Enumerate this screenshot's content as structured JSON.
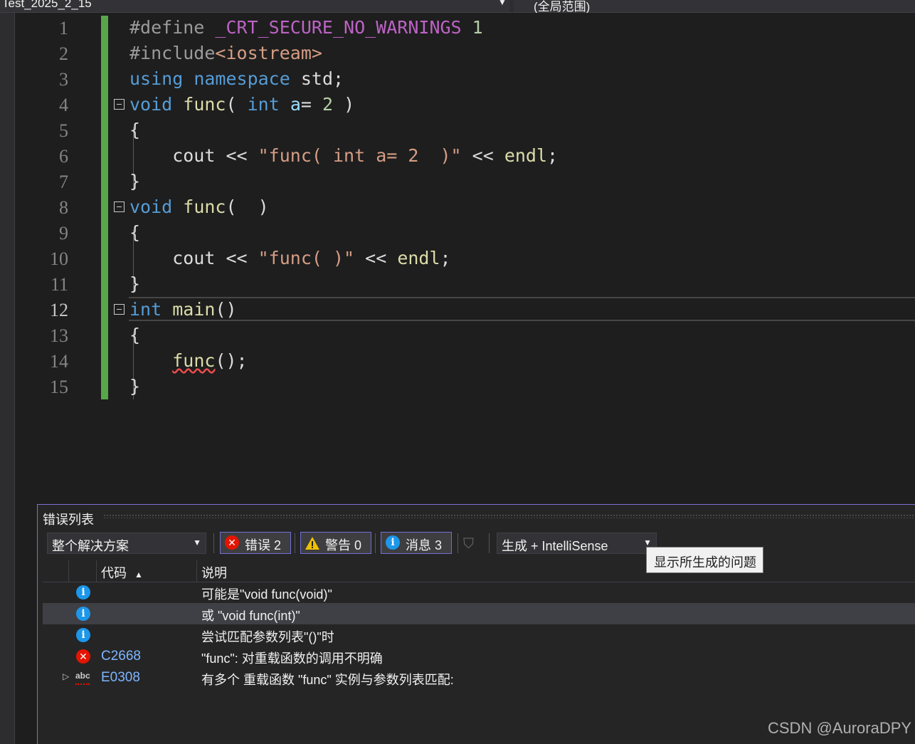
{
  "topbar": {
    "file_dropdown": "Test_2025_2_15",
    "scope_dropdown": "(全局范围)"
  },
  "editor": {
    "current_line": 12,
    "line_numbers": [
      "1",
      "2",
      "3",
      "4",
      "5",
      "6",
      "7",
      "8",
      "9",
      "10",
      "11",
      "12",
      "13",
      "14",
      "15"
    ]
  },
  "error_list": {
    "title": "错误列表",
    "scope_select": "整个解决方案",
    "errors_label": "错误 2",
    "warnings_label": "警告 0",
    "messages_label": "消息 3",
    "build_select": "生成 + IntelliSense",
    "tooltip": "显示所生成的问题",
    "columns": {
      "code": "代码",
      "description": "说明"
    },
    "rows": [
      {
        "icon": "info-icon",
        "code": "",
        "description": "可能是\"void func(void)\""
      },
      {
        "icon": "info-icon",
        "code": "",
        "description": "或    \"void func(int)\""
      },
      {
        "icon": "info-icon",
        "code": "",
        "description": "尝试匹配参数列表\"()\"时"
      },
      {
        "icon": "error-icon",
        "code": "C2668",
        "description": "\"func\": 对重载函数的调用不明确"
      },
      {
        "icon": "intellisense-abc-icon",
        "code": "E0308",
        "description": "有多个 重载函数 \"func\" 实例与参数列表匹配:"
      }
    ]
  },
  "watermark": "CSDN @AuroraDPY"
}
